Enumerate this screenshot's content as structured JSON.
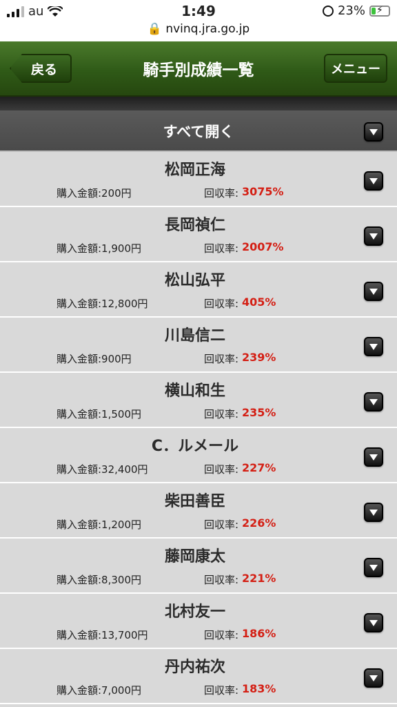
{
  "status_bar": {
    "carrier": "au",
    "time": "1:49",
    "url": "nvinq.jra.go.jp",
    "battery": "23%",
    "battery_level": 0.23
  },
  "header": {
    "back_label": "戻る",
    "title": "騎手別成績一覧",
    "menu_label": "メニュー"
  },
  "open_all": {
    "label": "すべて開く"
  },
  "labels": {
    "purchase_prefix": "購入金額:",
    "return_label": "回収率:"
  },
  "jockeys": [
    {
      "name": "松岡正海",
      "purchase": "購入金額:200円",
      "return_label": "回収率:",
      "return_rate": "3075%"
    },
    {
      "name": "長岡禎仁",
      "purchase": "購入金額:1,900円",
      "return_label": "回収率:",
      "return_rate": "2007%"
    },
    {
      "name": "松山弘平",
      "purchase": "購入金額:12,800円",
      "return_label": "回収率:",
      "return_rate": "405%"
    },
    {
      "name": "川島信二",
      "purchase": "購入金額:900円",
      "return_label": "回収率:",
      "return_rate": "239%"
    },
    {
      "name": "横山和生",
      "purchase": "購入金額:1,500円",
      "return_label": "回収率:",
      "return_rate": "235%"
    },
    {
      "name": "C．ルメール",
      "purchase": "購入金額:32,400円",
      "return_label": "回収率:",
      "return_rate": "227%"
    },
    {
      "name": "柴田善臣",
      "purchase": "購入金額:1,200円",
      "return_label": "回収率:",
      "return_rate": "226%"
    },
    {
      "name": "藤岡康太",
      "purchase": "購入金額:8,300円",
      "return_label": "回収率:",
      "return_rate": "221%"
    },
    {
      "name": "北村友一",
      "purchase": "購入金額:13,700円",
      "return_label": "回収率:",
      "return_rate": "186%"
    },
    {
      "name": "丹内祐次",
      "purchase": "購入金額:7,000円",
      "return_label": "回収率:",
      "return_rate": "183%"
    }
  ],
  "colors": {
    "header_green": "#2f5a17",
    "return_red": "#d41f14",
    "row_bg": "#d9d9d9"
  }
}
